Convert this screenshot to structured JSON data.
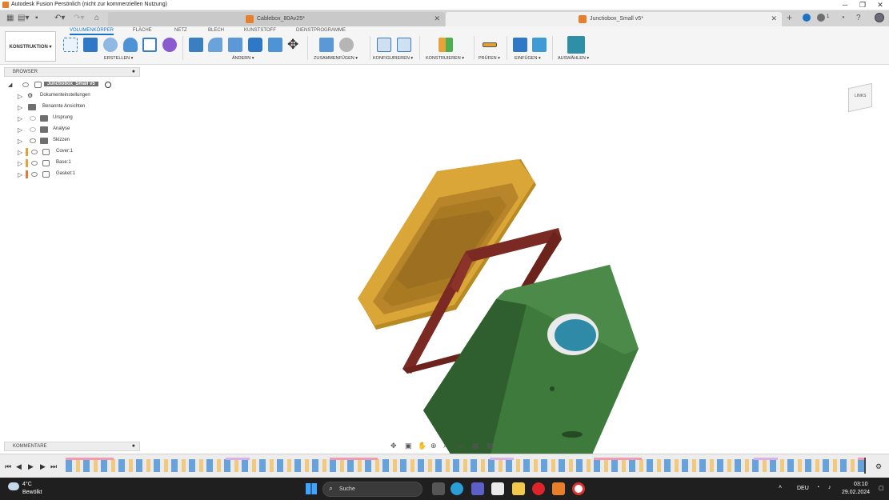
{
  "window": {
    "title": "Autodesk Fusion Persönlich (nicht zur kommerziellen Nutzung)",
    "minimize": "─",
    "maximize": "❐",
    "close": "✕"
  },
  "tabs": [
    {
      "label": "Cablebox_80Av25*",
      "active": false
    },
    {
      "label": "Junctiobox_Small v5*",
      "active": true
    }
  ],
  "tabbar_right": {
    "count": "1"
  },
  "workspace": "KONSTRUKTION ▾",
  "ribbon_tabs": [
    "VOLUMENKÖRPER",
    "FLÄCHE",
    "NETZ",
    "BLECH",
    "KUNSTSTOFF",
    "DIENSTPROGRAMME"
  ],
  "ribbon_groups": [
    "ERSTELLEN ▾",
    "ÄNDERN ▾",
    "ZUSAMMENFÜGEN ▾",
    "KONFIGURIEREN ▾",
    "KONSTRUIEREN ▾",
    "PRÜFEN ▾",
    "EINFÜGEN ▾",
    "AUSWÄHLEN ▾"
  ],
  "browser": {
    "title": "BROWSER",
    "root": "Junctiobox_Small v5",
    "items": [
      {
        "label": "Dokumenteinstellungen",
        "kind": "gear"
      },
      {
        "label": "Benannte Ansichten",
        "kind": "folder"
      },
      {
        "label": "Ursprung",
        "kind": "folder"
      },
      {
        "label": "Analyse",
        "kind": "folder"
      },
      {
        "label": "Skizzen",
        "kind": "folder"
      },
      {
        "label": "Cover:1",
        "kind": "body",
        "color": "#e6a23a"
      },
      {
        "label": "Base:1",
        "kind": "body",
        "color": "#e6a23a"
      },
      {
        "label": "Gasket:1",
        "kind": "body",
        "color": "#e07a3a"
      }
    ]
  },
  "comments": {
    "title": "KOMMENTARE"
  },
  "viewcube": {
    "face": "LINKS"
  },
  "taskbar": {
    "weather_temp": "4°C",
    "weather_desc": "Bewölkt",
    "search": "Suche",
    "lang": "DEU",
    "time": "03:10",
    "date": "29.02.2024"
  },
  "colors": {
    "cover": "#d9a637",
    "base": "#3f7a3d",
    "gasket": "#7a2a23",
    "accent": "#1a73c9"
  }
}
